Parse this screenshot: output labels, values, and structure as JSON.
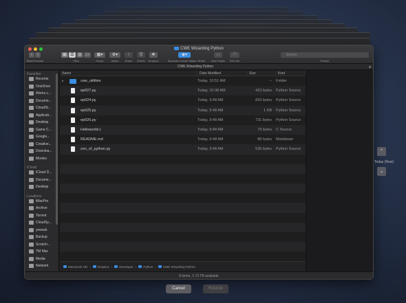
{
  "window": {
    "title": "CWE Wizarding Python",
    "tab_title": "CWE Wizarding Python"
  },
  "toolbar": {
    "back_forward_label": "Back/Forward",
    "view_label": "View",
    "group_label": "Group",
    "action_label": "Action",
    "share_label": "Share",
    "delete_label": "Delete",
    "dropbox_label": "Dropbox",
    "symbol_label": "Symbolic Create Station Share",
    "new_folder_label": "New Folder",
    "get_info_label": "Get Info",
    "search_placeholder": "Search",
    "search_label": "Search"
  },
  "sidebar": {
    "favorites_header": "Favorites",
    "favorites": [
      {
        "label": "Recents"
      },
      {
        "label": "OneDrive"
      },
      {
        "label": "Works.c..."
      },
      {
        "label": "Docume..."
      },
      {
        "label": "CloudSt..."
      },
      {
        "label": "Applicati..."
      },
      {
        "label": "Desktop"
      },
      {
        "label": "Game C..."
      },
      {
        "label": "Google..."
      },
      {
        "label": "Creative..."
      },
      {
        "label": "Downloa..."
      },
      {
        "label": "Movies"
      }
    ],
    "icloud_header": "iCloud",
    "icloud": [
      {
        "label": "iCloud D..."
      },
      {
        "label": "Docume..."
      },
      {
        "label": "Desktop"
      }
    ],
    "locations_header": "Locations",
    "locations": [
      {
        "label": "iMacPro"
      },
      {
        "label": "Archive"
      },
      {
        "label": "Torrent"
      },
      {
        "label": "CloudSy..."
      },
      {
        "label": "yewsuk"
      },
      {
        "label": "Backup"
      },
      {
        "label": "Scratch..."
      },
      {
        "label": "TM Mac"
      },
      {
        "label": "Media"
      },
      {
        "label": "Network"
      }
    ]
  },
  "columns": {
    "name": "Name",
    "date": "Date Modified",
    "size": "Size",
    "kind": "Kind"
  },
  "files": [
    {
      "name": "cwe_utilities",
      "date": "Today, 10:51 AM",
      "size": "--",
      "kind": "Folder",
      "type": "folder"
    },
    {
      "name": "ep027.py",
      "date": "Today, 10:38 AM",
      "size": "423 bytes",
      "kind": "Python Source",
      "type": "py"
    },
    {
      "name": "ep024.py",
      "date": "Today, 9:48 AM",
      "size": "833 bytes",
      "kind": "Python Source",
      "type": "py"
    },
    {
      "name": "ep025.py",
      "date": "Today, 9:48 AM",
      "size": "1 KB",
      "kind": "Python Source",
      "type": "py"
    },
    {
      "name": "ep026.py",
      "date": "Today, 9:48 AM",
      "size": "731 bytes",
      "kind": "Python Source",
      "type": "py"
    },
    {
      "name": "Helloworld.c",
      "date": "Today, 9:48 AM",
      "size": "79 bytes",
      "kind": "C Source",
      "type": "c"
    },
    {
      "name": "README.md",
      "date": "Today, 9:48 AM",
      "size": "88 bytes",
      "kind": "Markdown",
      "type": "md"
    },
    {
      "name": "zen_of_python.py",
      "date": "Today, 9:48 AM",
      "size": "536 bytes",
      "kind": "Python Source",
      "type": "py"
    }
  ],
  "path": [
    {
      "label": "Macintosh HD"
    },
    {
      "label": "Dropbox"
    },
    {
      "label": "Developer"
    },
    {
      "label": "Python"
    },
    {
      "label": "CWE Wizarding Python"
    }
  ],
  "status": {
    "text": "8 items, 1.73 TB available"
  },
  "buttons": {
    "cancel": "Cancel",
    "restore": "Restore"
  },
  "time_machine": {
    "today_label": "Today (Now)"
  }
}
